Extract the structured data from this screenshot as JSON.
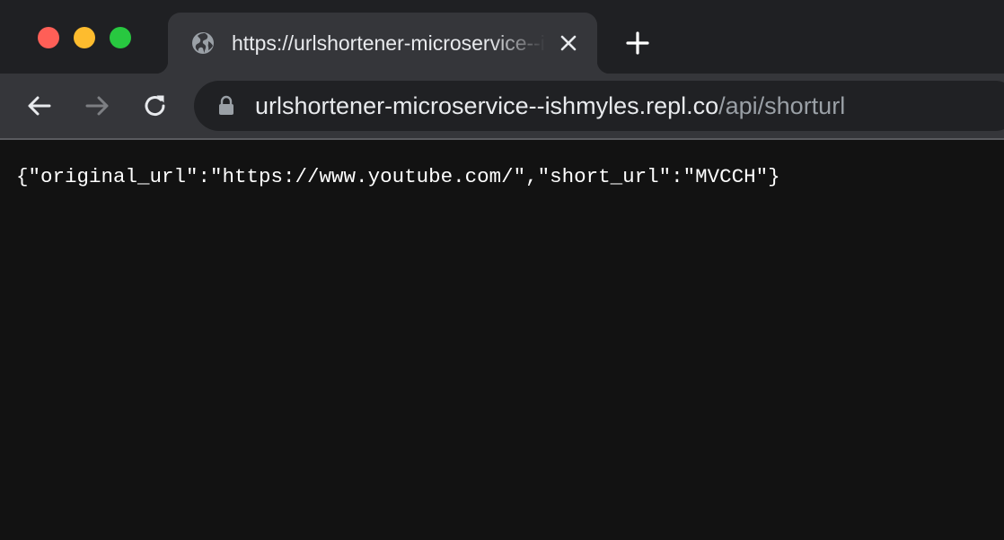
{
  "browser": {
    "tab": {
      "title": "https://urlshortener-microservice--ishmyles.repl.co/api/shorturl",
      "favicon": "globe-icon",
      "close_icon": "close-icon"
    },
    "new_tab_icon": "plus-icon",
    "toolbar": {
      "back_icon": "arrow-left-icon",
      "forward_icon": "arrow-right-icon",
      "reload_icon": "reload-icon",
      "lock_icon": "lock-icon",
      "url_host": "urlshortener-microservice--ishmyles.repl.co",
      "url_path": "/api/shorturl"
    },
    "colors": {
      "close": "#fe5f57",
      "minimize": "#febc2e",
      "maximize": "#28c840",
      "page_background": "#121212"
    }
  },
  "page": {
    "json_text": "{\"original_url\":\"https://www.youtube.com/\",\"short_url\":\"MVCCH\"}"
  }
}
